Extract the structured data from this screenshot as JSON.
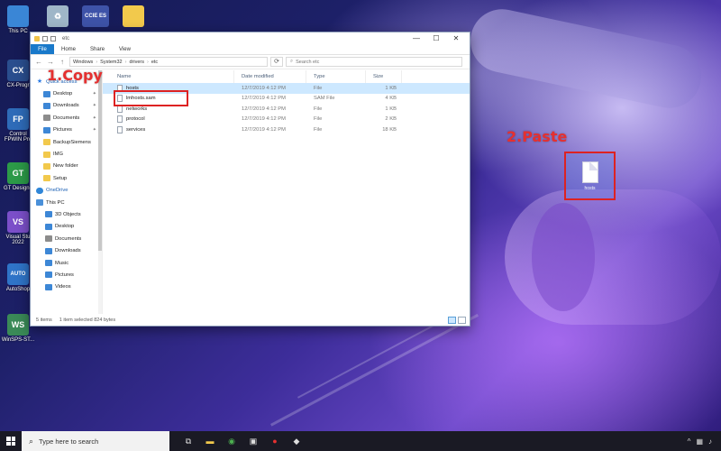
{
  "desktop": {
    "icons": [
      {
        "label": "This PC",
        "name": "this-pc",
        "color": "#3a86d6",
        "glyph": ""
      },
      {
        "label": "",
        "name": "recycle-bin",
        "color": "#9fb6c8",
        "glyph": "♻"
      },
      {
        "label": "",
        "name": "ccie-es",
        "color": "#3e53a8",
        "glyph": "CCIE ES"
      },
      {
        "label": "",
        "name": "folder",
        "color": "#f2c94c",
        "glyph": ""
      },
      {
        "label": "CX-Progr",
        "name": "cx-programmer",
        "color": "#2a4e8e",
        "glyph": "CX"
      },
      {
        "label": "Control FPWIN Pro",
        "name": "control-fpwin-pro",
        "color": "#2e6bb8",
        "glyph": "FP"
      },
      {
        "label": "GT Designe",
        "name": "gt-designer",
        "color": "#2c9a48",
        "glyph": "GT"
      },
      {
        "label": "Visual Stu 2022",
        "name": "visual-studio",
        "color": "#7b4fc9",
        "glyph": "VS"
      },
      {
        "label": "AutoShop",
        "name": "autoshop",
        "color": "#2f74c8",
        "glyph": "AUTO"
      },
      {
        "label": "WinSPS-ST...",
        "name": "winsps",
        "color": "#3a8a57",
        "glyph": "WS"
      }
    ]
  },
  "annotations": {
    "copy": "1.Copy",
    "paste": "2.Paste",
    "pasted_file": "hosts"
  },
  "window": {
    "title": "etc",
    "controls": {
      "minimize": "—",
      "maximize": "☐",
      "close": "✕"
    },
    "ribbon": {
      "file": "File",
      "tabs": [
        "Home",
        "Share",
        "View"
      ]
    },
    "nav": {
      "back": "←",
      "forward": "→",
      "up": "↑"
    },
    "address": [
      "Windows",
      "System32",
      "drivers",
      "etc"
    ],
    "search_placeholder": "Search etc",
    "nav_pane": [
      {
        "label": "Quick access",
        "kind": "head",
        "icon": "star"
      },
      {
        "label": "Desktop",
        "kind": "item",
        "icon": "blue",
        "pinned": true
      },
      {
        "label": "Downloads",
        "kind": "item",
        "icon": "blue",
        "pinned": true
      },
      {
        "label": "Documents",
        "kind": "item",
        "icon": "gray",
        "pinned": true
      },
      {
        "label": "Pictures",
        "kind": "item",
        "icon": "blue",
        "pinned": true
      },
      {
        "label": "BackupSiemens",
        "kind": "item",
        "icon": "yellow"
      },
      {
        "label": "IMG",
        "kind": "item",
        "icon": "yellow"
      },
      {
        "label": "New folder",
        "kind": "item",
        "icon": "yellow"
      },
      {
        "label": "Setup",
        "kind": "item",
        "icon": "yellow"
      },
      {
        "label": "OneDrive",
        "kind": "head",
        "icon": "cloud"
      },
      {
        "label": "This PC",
        "kind": "head-pc",
        "icon": "pc"
      },
      {
        "label": "3D Objects",
        "kind": "sub",
        "icon": "blue"
      },
      {
        "label": "Desktop",
        "kind": "sub",
        "icon": "blue"
      },
      {
        "label": "Documents",
        "kind": "sub",
        "icon": "gray"
      },
      {
        "label": "Downloads",
        "kind": "sub",
        "icon": "blue"
      },
      {
        "label": "Music",
        "kind": "sub",
        "icon": "blue"
      },
      {
        "label": "Pictures",
        "kind": "sub",
        "icon": "blue"
      },
      {
        "label": "Videos",
        "kind": "sub",
        "icon": "blue"
      }
    ],
    "columns": {
      "name": "Name",
      "date": "Date modified",
      "type": "Type",
      "size": "Size"
    },
    "files": [
      {
        "name": "hosts",
        "date": "12/7/2019 4:12 PM",
        "type": "File",
        "size": "1 KB",
        "selected": true
      },
      {
        "name": "lmhosts.sam",
        "date": "12/7/2019 4:12 PM",
        "type": "SAM File",
        "size": "4 KB",
        "selected": false
      },
      {
        "name": "networks",
        "date": "12/7/2019 4:12 PM",
        "type": "File",
        "size": "1 KB",
        "selected": false
      },
      {
        "name": "protocol",
        "date": "12/7/2019 4:12 PM",
        "type": "File",
        "size": "2 KB",
        "selected": false
      },
      {
        "name": "services",
        "date": "12/7/2019 4:12 PM",
        "type": "File",
        "size": "18 KB",
        "selected": false
      }
    ],
    "status": {
      "items": "5 items",
      "selected": "1 item selected  824 bytes"
    }
  },
  "taskbar": {
    "search_text": "Type here to search",
    "apps": [
      "task-view-icon",
      "file-explorer-icon",
      "chrome-icon",
      "app-icon",
      "record-icon",
      "app2-icon"
    ]
  }
}
